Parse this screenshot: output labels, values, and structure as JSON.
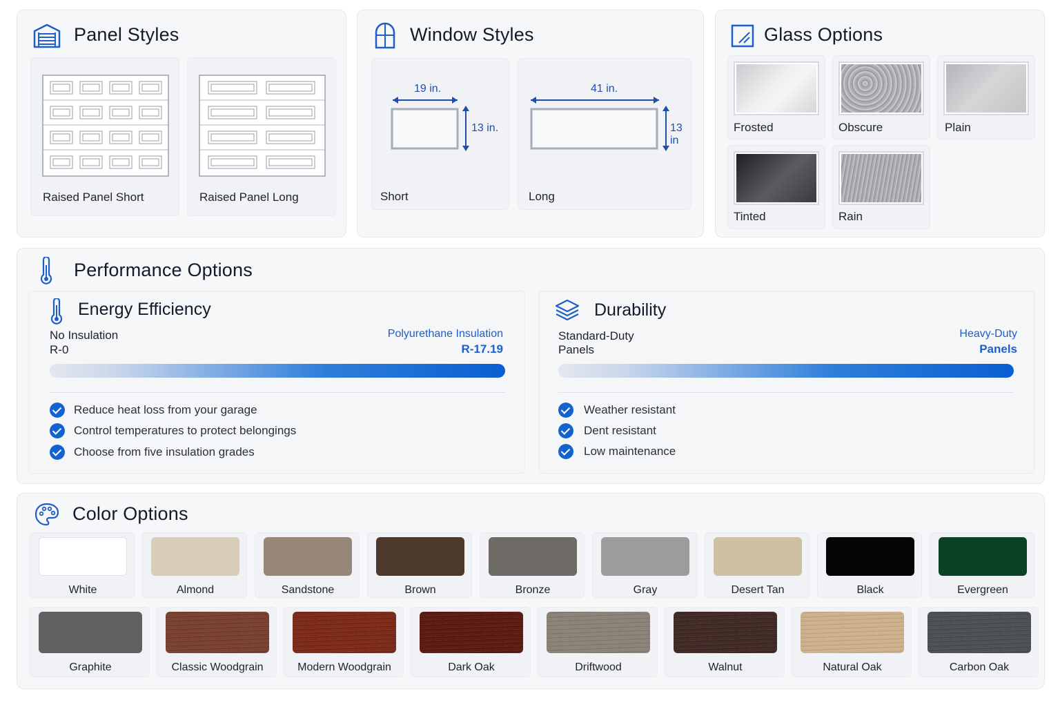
{
  "panel_styles": {
    "title": "Panel Styles",
    "items": [
      {
        "label": "Raised Panel Short"
      },
      {
        "label": "Raised Panel Long"
      }
    ]
  },
  "window_styles": {
    "title": "Window Styles",
    "items": [
      {
        "label": "Short",
        "width": "19 in.",
        "height": "13 in."
      },
      {
        "label": "Long",
        "width": "41 in.",
        "height": "13 in"
      }
    ]
  },
  "glass_options": {
    "title": "Glass Options",
    "items": [
      {
        "label": "Frosted"
      },
      {
        "label": "Obscure"
      },
      {
        "label": "Plain"
      },
      {
        "label": "Tinted"
      },
      {
        "label": "Rain"
      }
    ]
  },
  "performance": {
    "title": "Performance Options",
    "energy": {
      "title": "Energy Efficiency",
      "left_label": "No Insulation",
      "left_value": "R-0",
      "right_label": "Polyurethane Insulation",
      "right_value": "R-17.19",
      "features": [
        "Reduce heat loss from your garage",
        "Control temperatures to protect belongings",
        "Choose from five insulation grades"
      ]
    },
    "durability": {
      "title": "Durability",
      "left_label_1": "Standard-Duty",
      "left_label_2": "Panels",
      "right_label_1": "Heavy-Duty",
      "right_label_2": "Panels",
      "features": [
        "Weather resistant",
        "Dent resistant",
        "Low maintenance"
      ]
    }
  },
  "colors": {
    "title": "Color Options",
    "row1": [
      {
        "label": "White",
        "color": "#ffffff"
      },
      {
        "label": "Almond",
        "color": "#d8cdb8"
      },
      {
        "label": "Sandstone",
        "color": "#968778"
      },
      {
        "label": "Brown",
        "color": "#4d382c"
      },
      {
        "label": "Bronze",
        "color": "#6e6a66"
      },
      {
        "label": "Gray",
        "color": "#9c9c9c"
      },
      {
        "label": "Desert Tan",
        "color": "#cdc1a2"
      },
      {
        "label": "Black",
        "color": "#050505"
      },
      {
        "label": "Evergreen",
        "color": "#0b4226"
      }
    ],
    "row2": [
      {
        "label": "Graphite",
        "color": "#626162"
      },
      {
        "label": "Classic Woodgrain",
        "color": "#7a3e2a"
      },
      {
        "label": "Modern Woodgrain",
        "color": "#7e2614"
      },
      {
        "label": "Dark Oak",
        "color": "#5a160c"
      },
      {
        "label": "Driftwood",
        "color": "#8e8478"
      },
      {
        "label": "Walnut",
        "color": "#3e2620"
      },
      {
        "label": "Natural Oak",
        "color": "#d4b68e"
      },
      {
        "label": "Carbon Oak",
        "color": "#4a4e54"
      }
    ]
  }
}
